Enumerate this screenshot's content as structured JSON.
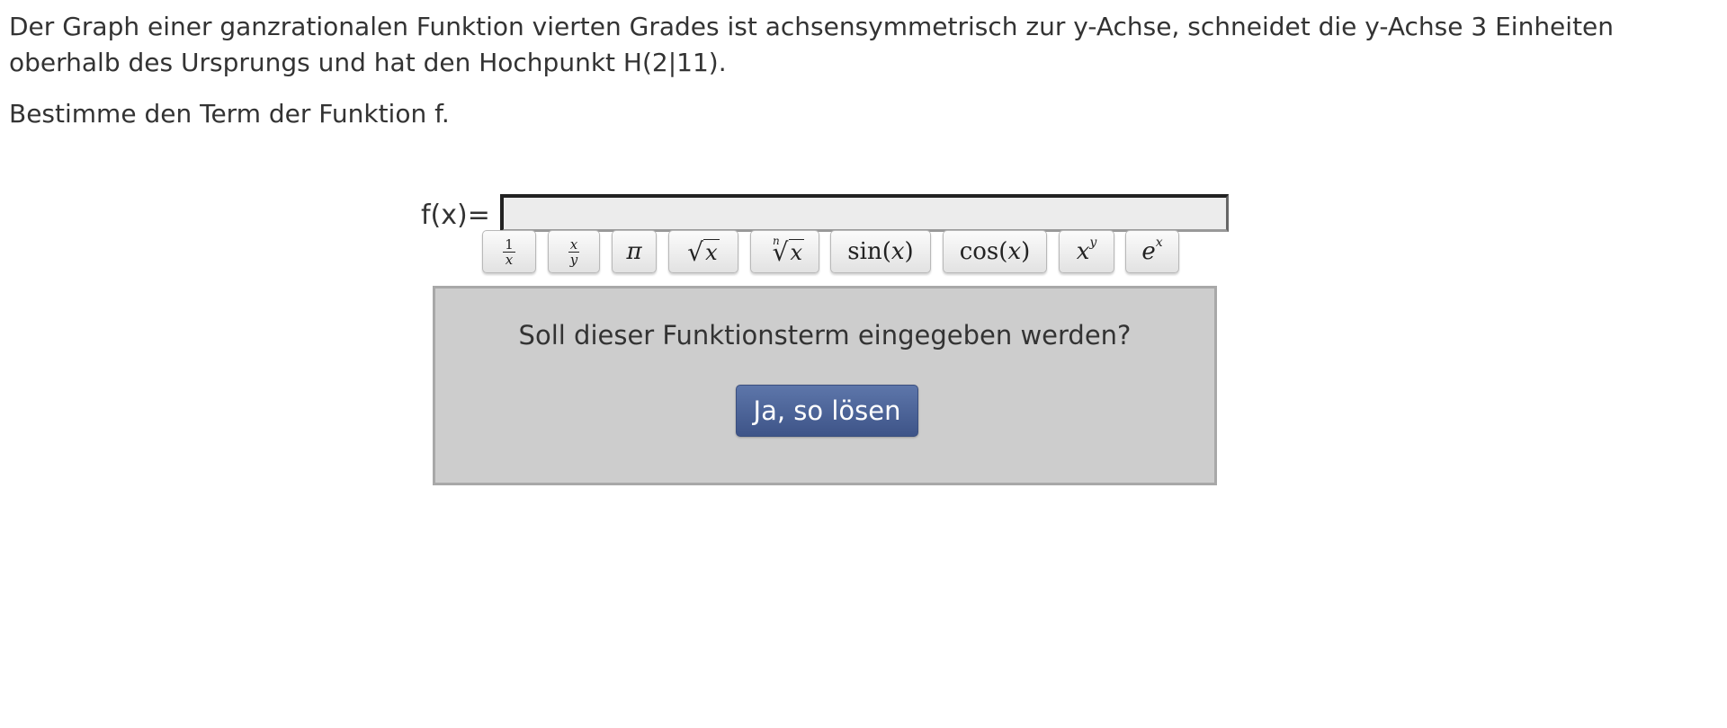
{
  "task": {
    "text": "Der Graph einer ganzrationalen Funktion vierten Grades ist achsensymmetrisch zur y-Achse, schneidet die y-Achse 3 Einheiten oberhalb des Ursprungs und hat den Hochpunkt H(2|11).",
    "instruction": "Bestimme den Term der Funktion f."
  },
  "answer": {
    "label": "f(x)=",
    "value": "",
    "placeholder": ""
  },
  "keypad": {
    "one_over_x": {
      "num": "1",
      "den": "x"
    },
    "x_over_y": {
      "num": "x",
      "den": "y"
    },
    "pi": "π",
    "sqrt": {
      "radical": "√",
      "radicand": "x"
    },
    "nthroot": {
      "index": "n",
      "radical": "√",
      "radicand": "x"
    },
    "sin": {
      "fn": "sin",
      "open": "(",
      "arg": "x",
      "close": ")"
    },
    "cos": {
      "fn": "cos",
      "open": "(",
      "arg": "x",
      "close": ")"
    },
    "power": {
      "base": "x",
      "exp": "y"
    },
    "exp": {
      "base": "e",
      "exp": "x"
    }
  },
  "confirm": {
    "question": "Soll dieser Funktionsterm eingegeben werden?",
    "button_label": "Ja, so lösen"
  },
  "colors": {
    "panel_bg": "#cdcdcd",
    "button_bg": "#4a6098",
    "input_bg": "#ececec"
  }
}
